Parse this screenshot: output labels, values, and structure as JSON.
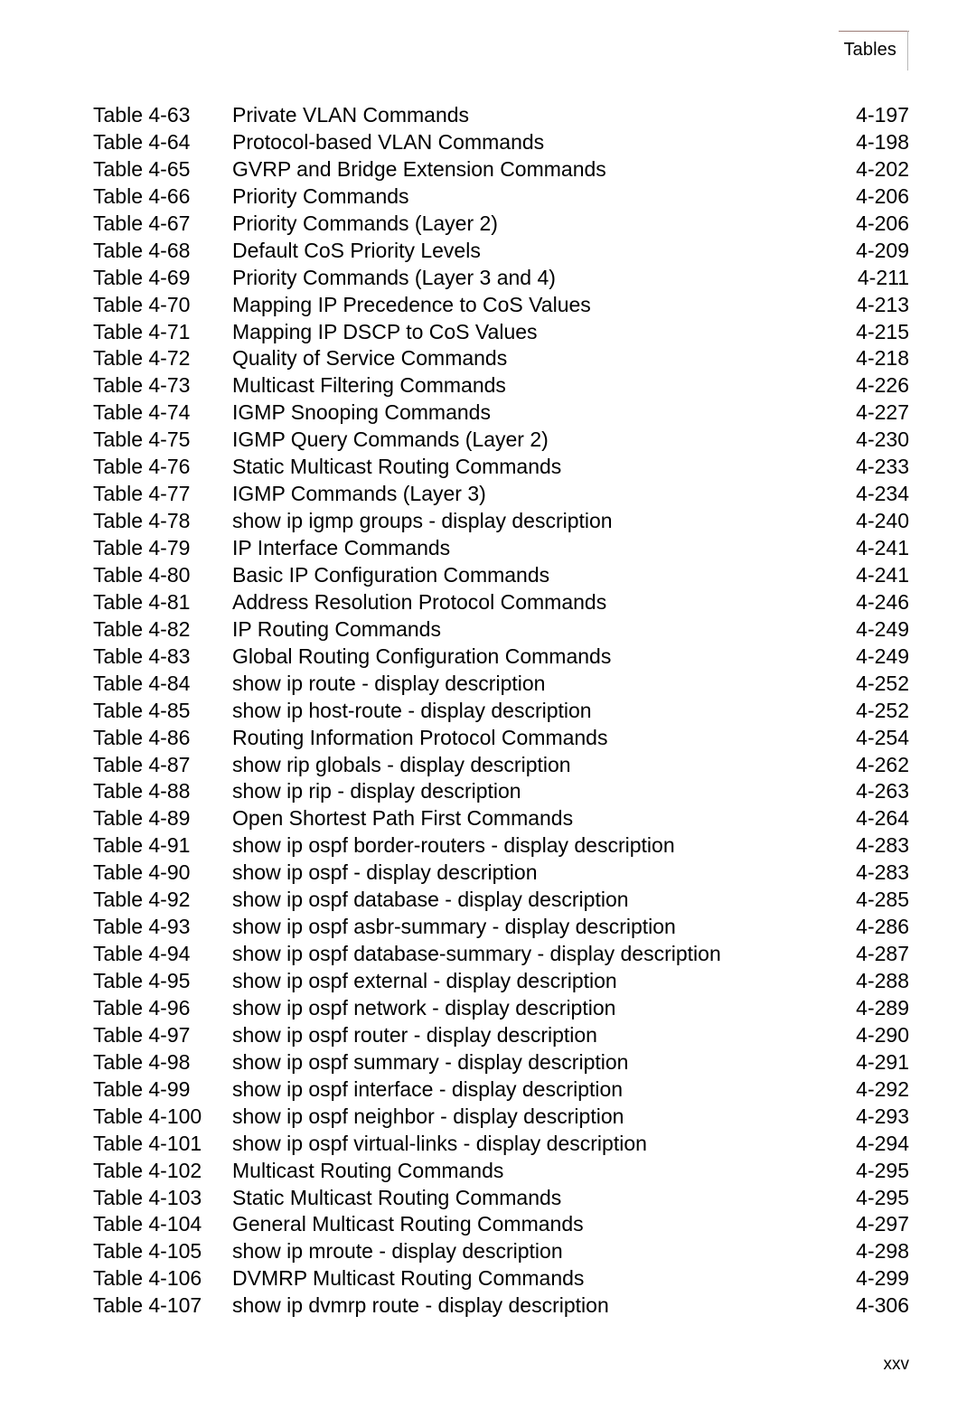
{
  "header": {
    "title": "Tables"
  },
  "footer": {
    "folio": "xxv"
  },
  "list_of_tables": {
    "rows": [
      {
        "label": "Table 4-63",
        "title": "Private VLAN Commands",
        "page": "4-197"
      },
      {
        "label": "Table 4-64",
        "title": "Protocol-based VLAN Commands",
        "page": "4-198"
      },
      {
        "label": "Table 4-65",
        "title": "GVRP and Bridge Extension Commands",
        "page": "4-202"
      },
      {
        "label": "Table 4-66",
        "title": "Priority Commands",
        "page": "4-206"
      },
      {
        "label": "Table 4-67",
        "title": "Priority Commands (Layer 2)",
        "page": "4-206"
      },
      {
        "label": "Table 4-68",
        "title": "Default CoS Priority Levels",
        "page": "4-209"
      },
      {
        "label": "Table 4-69",
        "title": "Priority Commands (Layer 3 and 4)",
        "page": "4-211"
      },
      {
        "label": "Table 4-70",
        "title": "Mapping IP Precedence to CoS Values",
        "page": "4-213"
      },
      {
        "label": "Table 4-71",
        "title": "Mapping IP DSCP to CoS Values",
        "page": "4-215"
      },
      {
        "label": "Table 4-72",
        "title": "Quality of Service Commands",
        "page": "4-218"
      },
      {
        "label": "Table 4-73",
        "title": "Multicast Filtering Commands",
        "page": "4-226"
      },
      {
        "label": "Table 4-74",
        "title": "IGMP Snooping Commands",
        "page": "4-227"
      },
      {
        "label": "Table 4-75",
        "title": "IGMP Query Commands (Layer 2)",
        "page": "4-230"
      },
      {
        "label": "Table 4-76",
        "title": "Static Multicast Routing Commands",
        "page": "4-233"
      },
      {
        "label": "Table 4-77",
        "title": "IGMP Commands (Layer 3)",
        "page": "4-234"
      },
      {
        "label": "Table 4-78",
        "title": "show ip igmp groups - display description",
        "page": "4-240"
      },
      {
        "label": "Table 4-79",
        "title": "IP Interface Commands",
        "page": "4-241"
      },
      {
        "label": "Table 4-80",
        "title": "Basic IP Configuration Commands",
        "page": "4-241"
      },
      {
        "label": "Table 4-81",
        "title": "Address Resolution Protocol Commands",
        "page": "4-246"
      },
      {
        "label": "Table 4-82",
        "title": "IP Routing Commands",
        "page": "4-249"
      },
      {
        "label": "Table 4-83",
        "title": "Global Routing Configuration Commands",
        "page": "4-249"
      },
      {
        "label": "Table 4-84",
        "title": "show ip route - display description",
        "page": "4-252"
      },
      {
        "label": "Table 4-85",
        "title": "show ip host-route - display description",
        "page": "4-252"
      },
      {
        "label": "Table 4-86",
        "title": "Routing Information Protocol Commands",
        "page": "4-254"
      },
      {
        "label": "Table 4-87",
        "title": "show rip globals - display description",
        "page": "4-262"
      },
      {
        "label": "Table 4-88",
        "title": "show ip rip - display description",
        "page": "4-263"
      },
      {
        "label": "Table 4-89",
        "title": "Open Shortest Path First Commands",
        "page": "4-264"
      },
      {
        "label": "Table 4-91",
        "title": "show ip ospf border-routers - display description",
        "page": "4-283"
      },
      {
        "label": "Table 4-90",
        "title": "show ip ospf - display description",
        "page": "4-283"
      },
      {
        "label": "Table 4-92",
        "title": "show ip ospf database - display description",
        "page": "4-285"
      },
      {
        "label": "Table 4-93",
        "title": "show ip ospf asbr-summary - display description",
        "page": "4-286"
      },
      {
        "label": "Table 4-94",
        "title": "show ip ospf database-summary - display description",
        "page": "4-287"
      },
      {
        "label": "Table 4-95",
        "title": "show ip ospf external - display description",
        "page": "4-288"
      },
      {
        "label": "Table 4-96",
        "title": "show ip ospf network - display description",
        "page": "4-289"
      },
      {
        "label": "Table 4-97",
        "title": "show ip ospf router - display description",
        "page": "4-290"
      },
      {
        "label": "Table 4-98",
        "title": "show ip ospf summary - display description",
        "page": "4-291"
      },
      {
        "label": "Table 4-99",
        "title": "show ip ospf interface - display description",
        "page": "4-292"
      },
      {
        "label": "Table 4-100",
        "title": "show ip ospf neighbor - display description",
        "page": "4-293"
      },
      {
        "label": "Table 4-101",
        "title": "show ip ospf virtual-links - display description",
        "page": "4-294"
      },
      {
        "label": "Table 4-102",
        "title": "Multicast Routing Commands",
        "page": "4-295"
      },
      {
        "label": "Table 4-103",
        "title": "Static Multicast Routing Commands",
        "page": "4-295"
      },
      {
        "label": "Table 4-104",
        "title": "General Multicast Routing Commands",
        "page": "4-297"
      },
      {
        "label": "Table 4-105",
        "title": "show ip mroute - display description",
        "page": "4-298"
      },
      {
        "label": "Table 4-106",
        "title": "DVMRP Multicast Routing Commands",
        "page": "4-299"
      },
      {
        "label": "Table 4-107",
        "title": "show ip dvmrp route - display description",
        "page": "4-306"
      }
    ]
  }
}
